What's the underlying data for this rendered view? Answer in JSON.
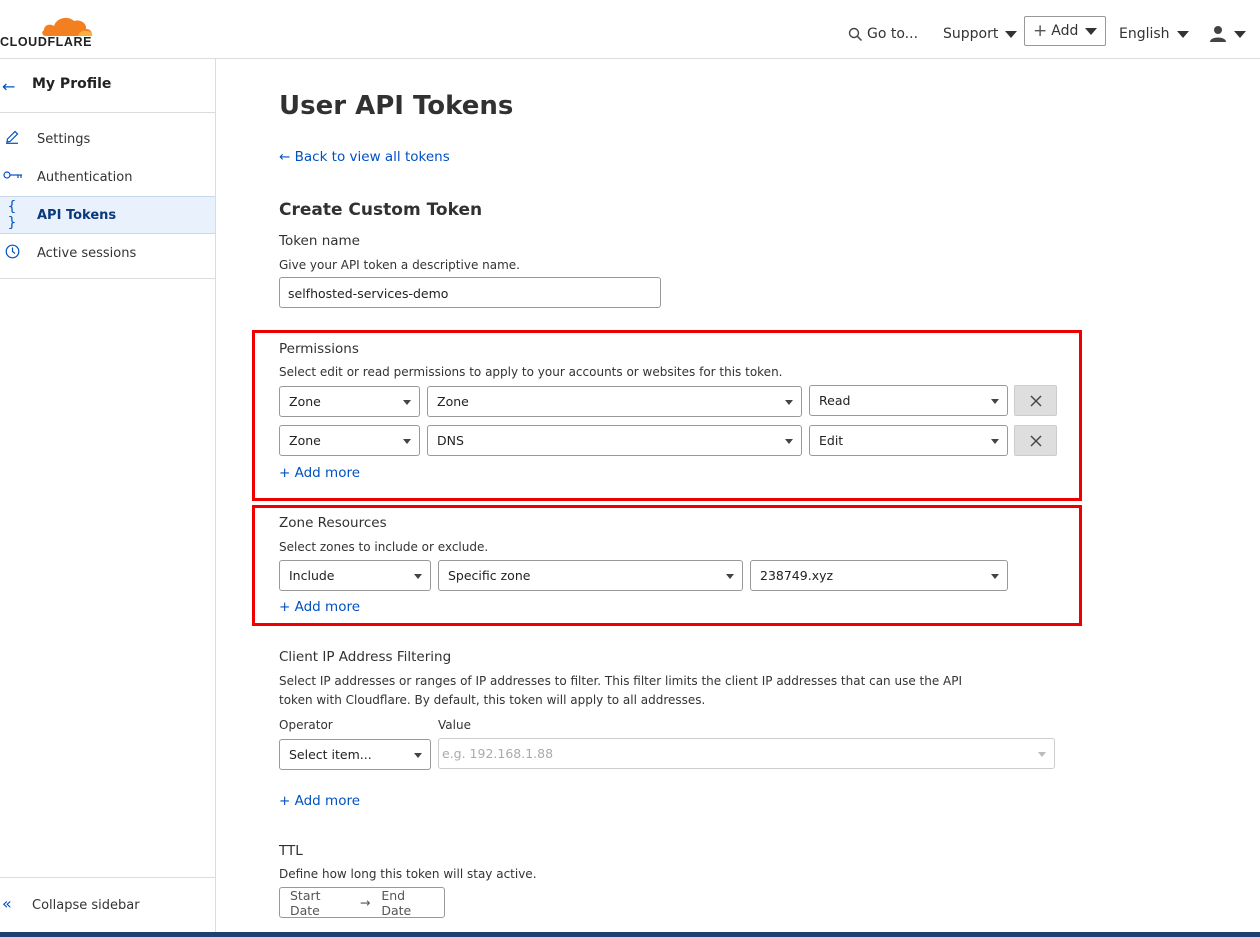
{
  "header": {
    "logo_text": "CLOUDFLARE",
    "goto_label": "Go to...",
    "support_label": "Support",
    "add_label": "Add",
    "language_label": "English"
  },
  "sidebar": {
    "title": "My Profile",
    "items": [
      {
        "label": "Settings",
        "icon": "pencil-icon"
      },
      {
        "label": "Authentication",
        "icon": "key-icon"
      },
      {
        "label": "API Tokens",
        "icon": "braces-icon",
        "active": true
      },
      {
        "label": "Active sessions",
        "icon": "clock-icon"
      }
    ],
    "collapse_label": "Collapse sidebar"
  },
  "main": {
    "page_title": "User API Tokens",
    "back_link": "Back to view all tokens",
    "section_title": "Create Custom Token",
    "token_name": {
      "label": "Token name",
      "help": "Give your API token a descriptive name.",
      "value": "selfhosted-services-demo"
    },
    "permissions": {
      "label": "Permissions",
      "help": "Select edit or read permissions to apply to your accounts or websites for this token.",
      "rows": [
        {
          "scope": "Zone",
          "resource": "Zone",
          "access": "Read"
        },
        {
          "scope": "Zone",
          "resource": "DNS",
          "access": "Edit"
        }
      ],
      "add_more": "Add more"
    },
    "zone_resources": {
      "label": "Zone Resources",
      "help": "Select zones to include or exclude.",
      "include": "Include",
      "type": "Specific zone",
      "zone": "238749.xyz",
      "add_more": "Add more"
    },
    "ip_filter": {
      "label": "Client IP Address Filtering",
      "help": "Select IP addresses or ranges of IP addresses to filter. This filter limits the client IP addresses that can use the API token with Cloudflare. By default, this token will apply to all addresses.",
      "operator_label": "Operator",
      "value_label": "Value",
      "operator_placeholder": "Select item...",
      "value_placeholder": "e.g. 192.168.1.88",
      "add_more": "Add more"
    },
    "ttl": {
      "label": "TTL",
      "help": "Define how long this token will stay active.",
      "start": "Start Date",
      "end": "End Date"
    }
  },
  "colors": {
    "accent": "#0051c3",
    "highlight_border": "#ee0000",
    "logo_orange": "#f38020"
  }
}
